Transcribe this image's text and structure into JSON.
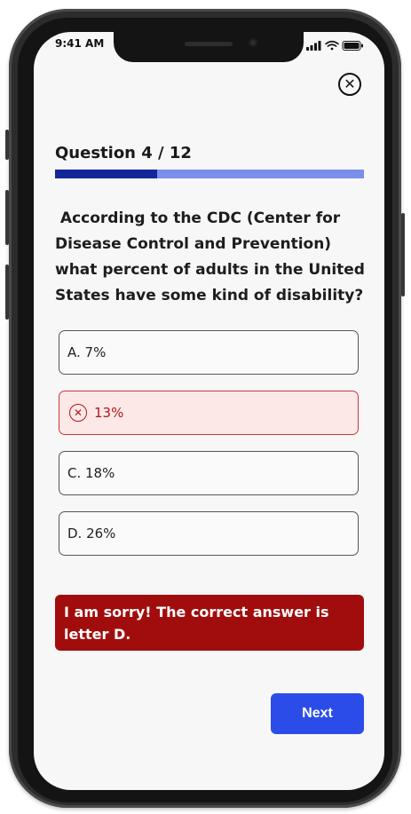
{
  "status_bar": {
    "time": "9:41 AM",
    "icons": [
      "signal-icon",
      "wifi-icon",
      "battery-icon"
    ]
  },
  "header": {
    "close_icon": "close-icon",
    "question_label": "Question 4 / 12",
    "progress": {
      "current": 4,
      "total": 12,
      "fraction": 0.33
    }
  },
  "question": {
    "text": " According to the CDC (Center for Disease Control and Prevention) what percent of adults in the United States have some kind of disability?"
  },
  "options": [
    {
      "label": "A. 7%",
      "state": "default"
    },
    {
      "label": "13%",
      "state": "incorrect",
      "icon": "x-circle-icon"
    },
    {
      "label": "C. 18%",
      "state": "default"
    },
    {
      "label": "D. 26%",
      "state": "default"
    }
  ],
  "feedback": {
    "text": "I am sorry! The correct answer is letter D."
  },
  "actions": {
    "next_label": "Next"
  },
  "colors": {
    "accent": "#2c4ce9",
    "progress_fill": "#13279a",
    "progress_track": "#7a8eeb",
    "error_background": "#a10d0d",
    "wrong_option_background": "#fde8e8",
    "wrong_option_text": "#b01818"
  }
}
